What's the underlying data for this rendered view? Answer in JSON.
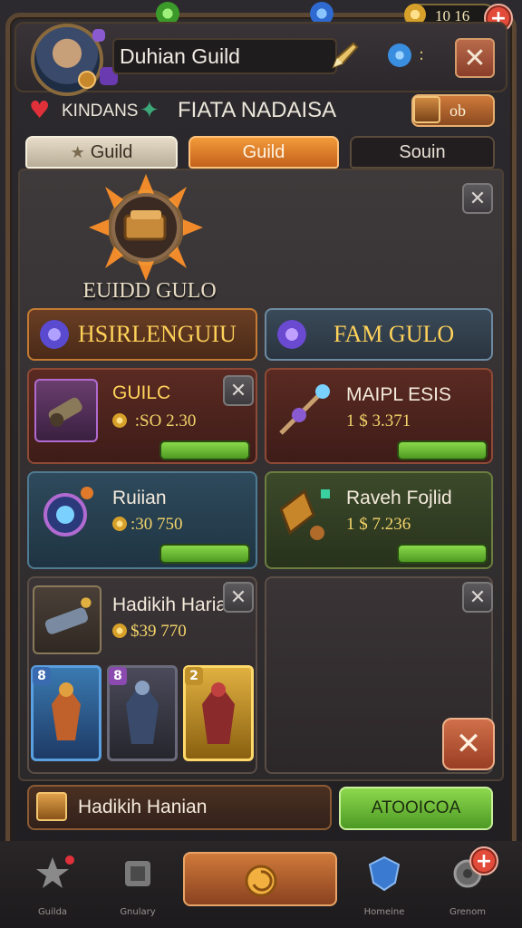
{
  "header": {
    "player_name": "Duhian Guild",
    "coins": "10 16",
    "close_label": "✕"
  },
  "stats": {
    "stat1_label": "KINDANS",
    "stat2_label": "FIATA NADAISA",
    "badge_value": "ob"
  },
  "tabs": [
    {
      "label": "Guild",
      "state": "normal"
    },
    {
      "label": "Guild",
      "state": "active"
    },
    {
      "label": "Souin",
      "state": "normal"
    }
  ],
  "emblem": {
    "title": "EUIDD GULO"
  },
  "guild_headers": [
    {
      "label": "HSIRLENGUIU"
    },
    {
      "label": "FAM GULO"
    }
  ],
  "cards": [
    {
      "title": "GUILC",
      "price": " :SO 2.30"
    },
    {
      "title": "MAIPL ESIS",
      "price": "1 $ 3.371"
    },
    {
      "title": "Ruiian",
      "price": ":30 750"
    },
    {
      "title": "Raveh Fojlid",
      "price": "1 $ 7.236"
    },
    {
      "title": "Hadikih Harian",
      "price": "$39 770"
    }
  ],
  "heroes": [
    {
      "num": "8"
    },
    {
      "num": "8"
    },
    {
      "num": "2"
    }
  ],
  "bottom": {
    "input_value": "Hadikih Hanian",
    "action_label": "ATOOICOA"
  },
  "nav": [
    {
      "label": "Guilda"
    },
    {
      "label": "Gnulary"
    },
    {
      "label": ""
    },
    {
      "label": "Homeine"
    },
    {
      "label": "Grenom"
    }
  ],
  "colors": {
    "accent_orange": "#d07a3a",
    "accent_green": "#6ec03a",
    "gold_text": "#ffd25a"
  }
}
